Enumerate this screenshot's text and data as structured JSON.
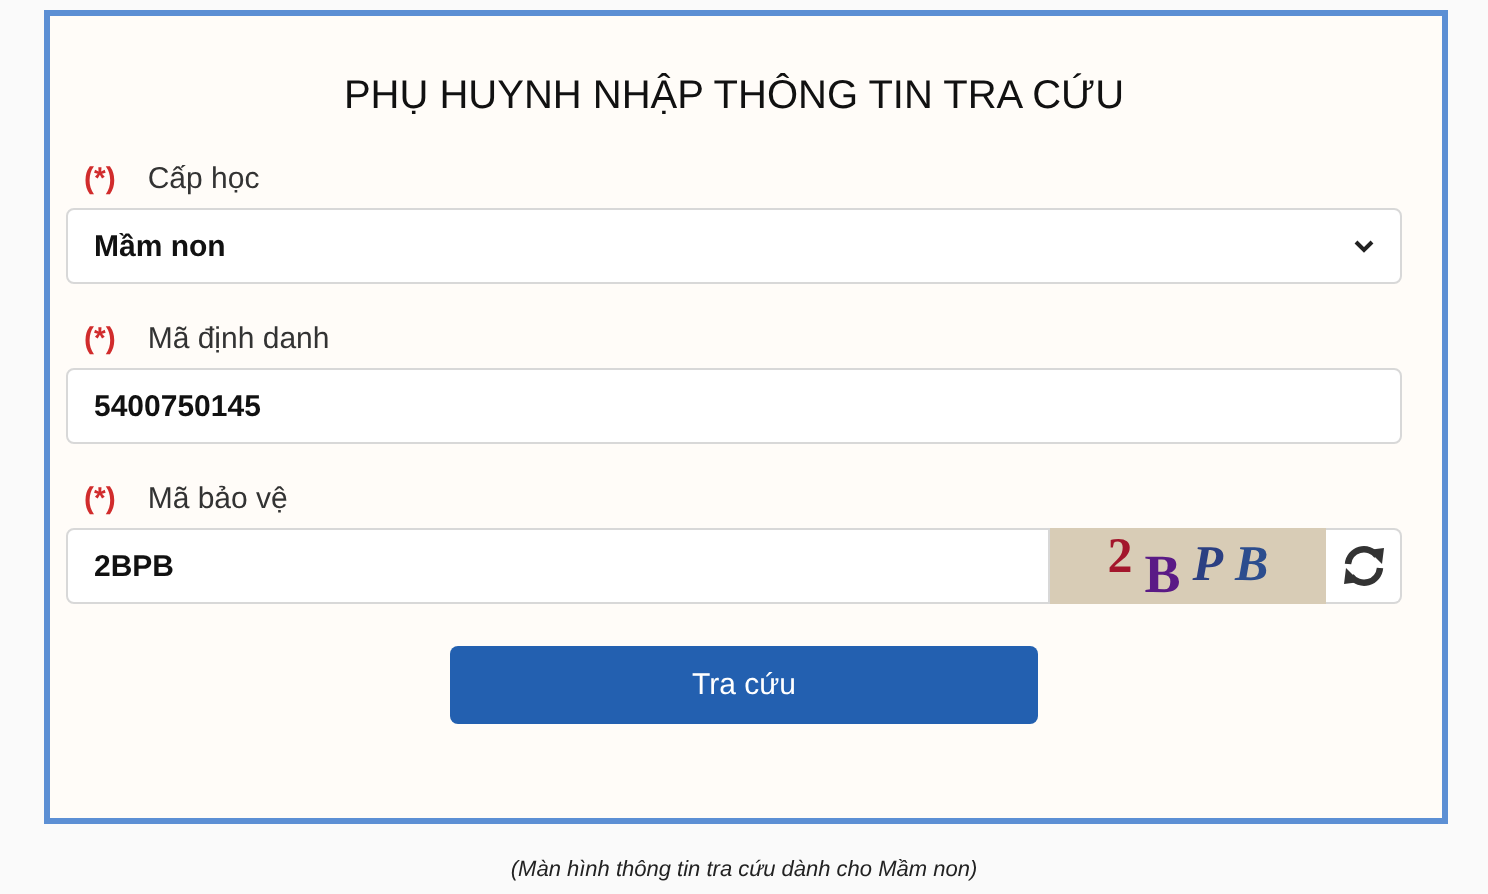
{
  "title": "PHỤ HUYNH NHẬP THÔNG TIN TRA CỨU",
  "fields": [
    {
      "kind": "select",
      "required_mark": "(*)",
      "label": "Cấp học",
      "value": "Mầm non"
    },
    {
      "kind": "text",
      "required_mark": "(*)",
      "label": "Mã định danh",
      "value": "5400750145"
    },
    {
      "kind": "captcha",
      "required_mark": "(*)",
      "label": "Mã bảo vệ",
      "value": "2BPB",
      "captcha": [
        {
          "text": "2",
          "color": "#a3162c"
        },
        {
          "text": "B",
          "color": "#5a1a86"
        },
        {
          "text": "P",
          "color": "#2b3f82"
        },
        {
          "text": "B",
          "color": "#2c4d8e"
        }
      ]
    }
  ],
  "submit": "Tra cứu",
  "caption": "(Màn hình thông tin tra cứu dành cho Mầm non)"
}
